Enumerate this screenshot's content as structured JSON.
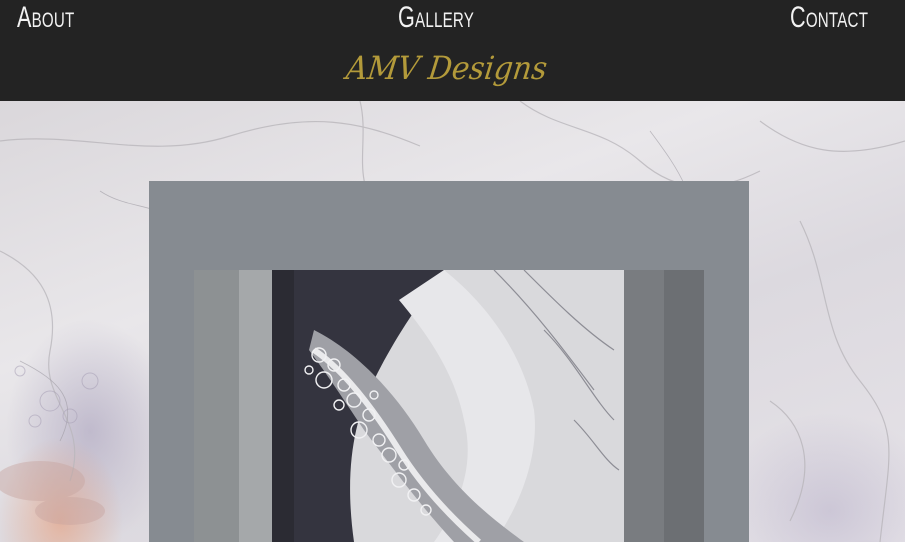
{
  "nav": {
    "about": "About",
    "gallery": "Gallery",
    "contact": "Contact"
  },
  "brand": {
    "name": "AMV Designs",
    "color": "#b39a3a"
  },
  "colors": {
    "header_bg": "#232323",
    "nav_text": "#f2f2f2",
    "card_bg": "#868b91"
  },
  "gallery": {
    "image_icon": "marble-painting-image"
  }
}
